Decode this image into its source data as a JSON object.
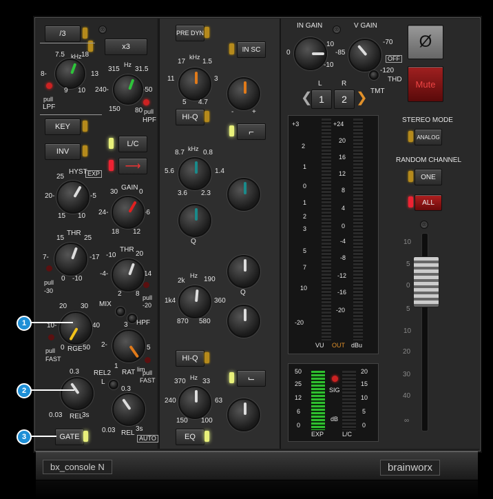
{
  "col1": {
    "btn_div3": "/3",
    "btn_x3": "x3",
    "lpf": {
      "scale": [
        "7.5",
        "18",
        "kHz",
        "8-",
        "13",
        "9",
        "10"
      ],
      "pull": "pull",
      "name": "LPF"
    },
    "hpf": {
      "scale": [
        "315",
        "Hz",
        "31.5",
        "240-",
        "-50",
        "150",
        "80"
      ],
      "pull": "pull",
      "name": "HPF"
    },
    "btn_key": "KEY",
    "btn_inv": "INV",
    "btn_lc": "L/C",
    "hyst": {
      "label": "HYST",
      "exp": "EXP",
      "scale": [
        "25",
        "20-",
        "-5",
        "15",
        "10"
      ]
    },
    "gain": {
      "label": "GAIN",
      "scale": [
        "30",
        "0",
        "24-",
        "-6",
        "18",
        "12"
      ]
    },
    "thr1": {
      "label": "THR",
      "scale": [
        "15",
        "25",
        "7-",
        "-17",
        "0",
        "-10"
      ],
      "pull": "pull",
      "val": "-30"
    },
    "thr2": {
      "label": "THR",
      "scale": [
        "-10",
        "20",
        "-4-",
        "14",
        "2",
        "8"
      ],
      "pull": "pull",
      "val": "-20"
    },
    "mix": "MIX",
    "hpf_small": "HPF",
    "rge": {
      "label": "RGE",
      "scale": [
        "20",
        "30",
        "10-",
        "40",
        "0",
        "50"
      ],
      "pull": "pull",
      "fast": "FAST"
    },
    "rat": {
      "label": "RAT",
      "scale": [
        "3",
        "2-",
        "5",
        "1",
        "lim"
      ],
      "pull": "pull",
      "fast": "FAST"
    },
    "rel1": {
      "label": "REL",
      "scale": [
        "0.3",
        "0.03",
        "3s"
      ]
    },
    "rel2": {
      "label": "REL",
      "top": "REL2",
      "l": "L",
      "scale": [
        "0.3",
        "0.03",
        "3s"
      ],
      "auto": "AUTO"
    },
    "btn_gate": "GATE"
  },
  "col2": {
    "btn_predyn": "PRE DYN",
    "btn_insc": "IN SC",
    "hf": {
      "scale": [
        "17",
        "kHz",
        "1.5",
        "11",
        "3",
        "5",
        "4.7"
      ]
    },
    "btn_hiq1": "HI-Q",
    "mf": {
      "scale": [
        "8.7",
        "kHz",
        "0.8",
        "5.6",
        "1.4",
        "3.6",
        "2.3"
      ],
      "q": "Q"
    },
    "lmf": {
      "scale": [
        "2k",
        "Hz",
        "190",
        "1k4",
        "360",
        "870",
        "580"
      ],
      "q": "Q"
    },
    "btn_hiq2": "HI-Q",
    "lf": {
      "scale": [
        "370",
        "Hz",
        "33",
        "240",
        "63",
        "150",
        "100"
      ]
    },
    "btn_eq": "EQ",
    "minus": "-",
    "plus": "+"
  },
  "col3": {
    "in_gain": {
      "label": "IN GAIN",
      "scale": [
        "0",
        "10",
        "-10"
      ]
    },
    "v_gain": {
      "label": "V GAIN",
      "scale": [
        "-85",
        "-70",
        "OFF",
        "-120"
      ]
    },
    "thd": "THD",
    "tmt": "TMT",
    "phase": "Ø",
    "mute": "Mute",
    "ch_l": "L",
    "ch_r": "R",
    "ch1": "1",
    "ch2": "2",
    "stereo_mode": "STEREO MODE",
    "analog": "ANALOG",
    "random_channel": "RANDOM CHANNEL",
    "one": "ONE",
    "all": "ALL",
    "vu_left": [
      "+3",
      "2",
      "1",
      "0",
      "1",
      "2",
      "3",
      "5",
      "7",
      "10",
      "-20"
    ],
    "vu_right": [
      "+24",
      "20",
      "16",
      "12",
      "8",
      "4",
      "0",
      "-4",
      "-8",
      "-12",
      "-16",
      "-20"
    ],
    "vu_foot": [
      "VU",
      "OUT",
      "dBu"
    ],
    "gr_left": [
      "50",
      "25",
      "12",
      "6",
      "0"
    ],
    "gr_right": [
      "20",
      "15",
      "10",
      "5",
      "0"
    ],
    "gr_foot": [
      "EXP",
      "dB",
      "L/C"
    ],
    "sig": "SIG",
    "fader_scale": [
      "10",
      "5",
      "0",
      "5",
      "10",
      "20",
      "30",
      "40",
      "∞"
    ]
  },
  "footer": {
    "plugin_name": "bx_console N",
    "brand": "brainworx"
  },
  "callouts": [
    "1",
    "2",
    "3"
  ],
  "colors": {
    "accent_blue": "#1e8fd6",
    "knob_green": "#2ec43a",
    "knob_red": "#e02020",
    "knob_yellow": "#f2c21a",
    "knob_orange": "#e07a1a",
    "knob_teal": "#1a8a8a"
  }
}
